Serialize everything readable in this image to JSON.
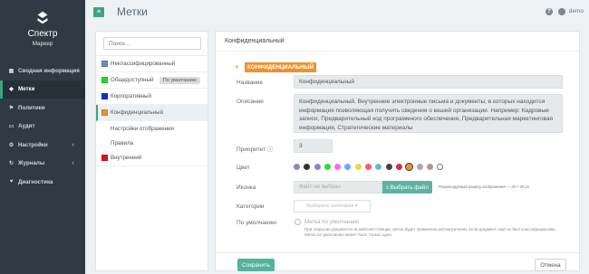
{
  "brand": {
    "title": "Спектр",
    "subtitle": "Маркер",
    "logo_icon": "spectr-logo-icon"
  },
  "sidebar": {
    "items": [
      {
        "label": "Сводная информация",
        "icon": "dashboard-icon",
        "glyph": "▦",
        "active": false,
        "caret": false
      },
      {
        "label": "Метки",
        "icon": "tag-icon",
        "glyph": "◆",
        "active": true,
        "caret": false
      },
      {
        "label": "Политики",
        "icon": "policy-icon",
        "glyph": "⚑",
        "active": false,
        "caret": false
      },
      {
        "label": "Аудит",
        "icon": "audit-icon",
        "glyph": "▭",
        "active": false,
        "caret": false
      },
      {
        "label": "Настройки",
        "icon": "gear-icon",
        "glyph": "⚙",
        "active": false,
        "caret": true
      },
      {
        "label": "Журналы",
        "icon": "journal-icon",
        "glyph": "↻",
        "active": false,
        "caret": true
      },
      {
        "label": "Диагностика",
        "icon": "diagnostics-icon",
        "glyph": "♥",
        "active": false,
        "caret": false
      }
    ]
  },
  "topbar": {
    "title": "Метки",
    "user": "demo",
    "menu_icon": "hamburger-icon",
    "help_icon": "help-icon",
    "user_icon": "user-icon"
  },
  "left": {
    "search_placeholder": "Поиск...",
    "categories": [
      {
        "label": "Неклассифицированный",
        "color": "#6f8fb7",
        "badge": "",
        "active": false
      },
      {
        "label": "Общедоступный",
        "color": "#22dd22",
        "badge": "По умолчанию",
        "active": false
      },
      {
        "label": "Корпоративный",
        "color": "#1d2fc4",
        "badge": "",
        "active": false
      },
      {
        "label": "Конфиденциальный",
        "color": "#f0922a",
        "badge": "",
        "active": true
      }
    ],
    "sub_items": [
      "Настройки отображения",
      "Правила"
    ],
    "last_category": {
      "label": "Внутренний",
      "color": "#e0102a"
    }
  },
  "detail": {
    "header": "Конфиденциальный",
    "tag": "КОНФИДЕНЦИАЛЬНЫЙ",
    "name_label": "Название",
    "name_value": "Конфиденциальный",
    "desc_label": "Описание",
    "desc_value": "Конфиденциальный. Внутренние электронные письма и документы, в которых находится информация позволяющая получить сведения о вашей организации. Например: Кадровые записи, Предварительный код программного обеспечения, Предварительная маркетинговая информация, Стратегические материалы",
    "priority_label": "Приоритет",
    "priority_value": "3",
    "color_label": "Цвет",
    "colors": [
      "#7f92b5",
      "#333333",
      "#7a8cd6",
      "#33dd33",
      "#ff66ff",
      "#66aaff",
      "#dddd44",
      "#ff5577",
      "#66bbcc",
      "#444444",
      "#cc3344",
      "#f0922a",
      "#aaaaaa",
      "#b59a80",
      "#ffffff"
    ],
    "selected_color_index": 11,
    "icon_label": "Иконка",
    "file_placeholder": "Файл не выбран",
    "file_button": "Выбрать файл",
    "file_hint": "Рекомендуемый размер изображения — 20 × 20 px",
    "categories_label": "Категории",
    "categories_placeholder": "Выберите категории ▾",
    "default_label": "По умолчанию",
    "default_radio_label": "Метка по умолчанию",
    "default_help_1": "При открытии документа на рабочей станции, метка будет применена автоматически, если документ ещё не был классифицирован",
    "default_help_2": "Метка по умолчанию может быть только одна",
    "save": "Сохранить",
    "cancel": "Отмена"
  }
}
